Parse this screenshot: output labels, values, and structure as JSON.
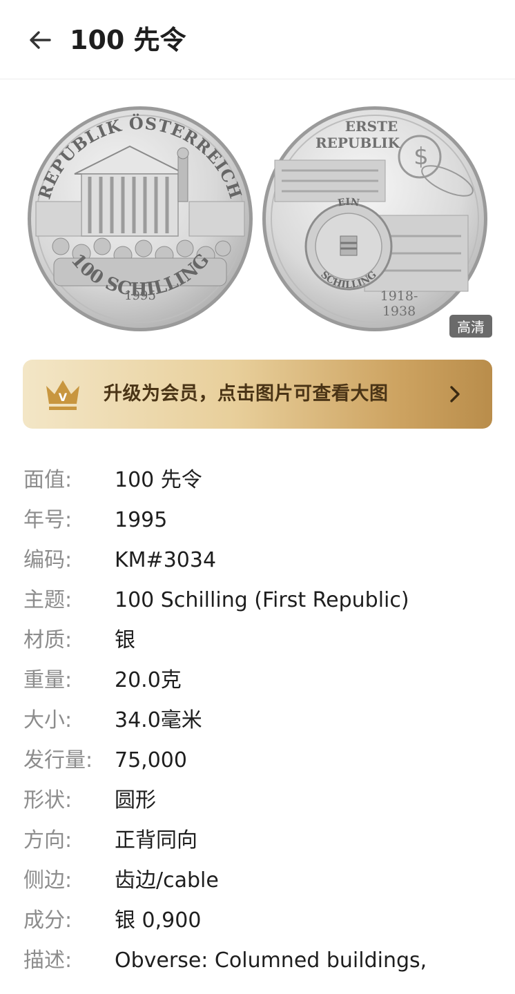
{
  "header": {
    "title": "100 先令",
    "back_icon": "arrow-left-icon"
  },
  "images": {
    "hd_badge": "高清",
    "obverse": {
      "top_legend": "REPUBLIK ÖSTERREICH",
      "year": "1995",
      "denomination": "100 SCHILLING"
    },
    "reverse": {
      "top_line1": "ERSTE",
      "top_line2": "REPUBLIK",
      "small_coin_top": "EIN",
      "small_coin_bottom": "SCHILLING",
      "years_line1": "1918-",
      "years_line2": "1938"
    }
  },
  "vip_banner": {
    "crown_icon": "crown-icon",
    "crown_letter": "V",
    "text": "升级为会员，点击图片可查看大图",
    "arrow_icon": "chevron-right-icon",
    "colors": {
      "start": "#f3e6c6",
      "end": "#b98d4b",
      "text": "#4a3416"
    }
  },
  "details": [
    {
      "label": "面值:",
      "value": "100 先令"
    },
    {
      "label": "年号:",
      "value": "1995"
    },
    {
      "label": "编码:",
      "value": "KM#3034"
    },
    {
      "label": "主题:",
      "value": "100 Schilling (First Republic)"
    },
    {
      "label": "材质:",
      "value": "银"
    },
    {
      "label": "重量:",
      "value": "20.0克"
    },
    {
      "label": "大小:",
      "value": "34.0毫米"
    },
    {
      "label": "发行量:",
      "value": "75,000"
    },
    {
      "label": "形状:",
      "value": "圆形"
    },
    {
      "label": "方向:",
      "value": "正背同向"
    },
    {
      "label": "侧边:",
      "value": "齿边/cable"
    },
    {
      "label": "成分:",
      "value": "银 0,900"
    },
    {
      "label": "描述:",
      "value": "Obverse: Columned buildings,"
    }
  ]
}
